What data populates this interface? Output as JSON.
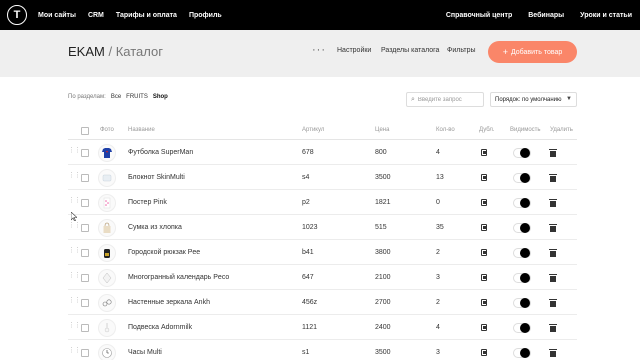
{
  "topbar": {
    "logo": "T",
    "left_nav": [
      "Мои сайты",
      "CRM",
      "Тарифы и оплата",
      "Профиль"
    ],
    "right_nav": [
      "Справочный центр",
      "Вебинары",
      "Уроки и статьи"
    ]
  },
  "header": {
    "title_store": "EKAM",
    "title_separator": "/",
    "title_section": "Каталог",
    "more_label": "···",
    "links": [
      "Настройки",
      "Разделы каталога",
      "Фильтры"
    ],
    "add_button": "Добавить товар"
  },
  "filter": {
    "label": "По разделам:",
    "chips": [
      "Все",
      "FRUITS",
      "Shop"
    ],
    "active": "Shop"
  },
  "search": {
    "placeholder": "Введите запрос"
  },
  "sort": {
    "value": "Порядок: по умолчанию"
  },
  "columns": [
    "Фото",
    "Название",
    "Артикул",
    "Цена",
    "Кол-во",
    "Дубл.",
    "Видимость",
    "Удалить"
  ],
  "products": [
    {
      "name": "Футболка SuperMan",
      "sku": "678",
      "price": "800",
      "qty": "4",
      "visible": true
    },
    {
      "name": "Блокнот SkinMulti",
      "sku": "s4",
      "price": "3500",
      "qty": "13",
      "visible": true
    },
    {
      "name": "Постер Pink",
      "sku": "p2",
      "price": "1821",
      "qty": "0",
      "visible": true
    },
    {
      "name": "Сумка из хлопка",
      "sku": "1023",
      "price": "515",
      "qty": "35",
      "visible": true
    },
    {
      "name": "Городской рюкзак Pee",
      "sku": "b41",
      "price": "3800",
      "qty": "2",
      "visible": true
    },
    {
      "name": "Многогранный календарь Peco",
      "sku": "647",
      "price": "2100",
      "qty": "3",
      "visible": true
    },
    {
      "name": "Настенные зеркала Ankh",
      "sku": "456z",
      "price": "2700",
      "qty": "2",
      "visible": true
    },
    {
      "name": "Подвеска Adornmilk",
      "sku": "1121",
      "price": "2400",
      "qty": "4",
      "visible": true
    },
    {
      "name": "Часы Multi",
      "sku": "s1",
      "price": "3500",
      "qty": "3",
      "visible": true
    }
  ],
  "colors": {
    "accent": "#fa8669",
    "topbar": "#000000",
    "header_bg": "#efefef"
  }
}
